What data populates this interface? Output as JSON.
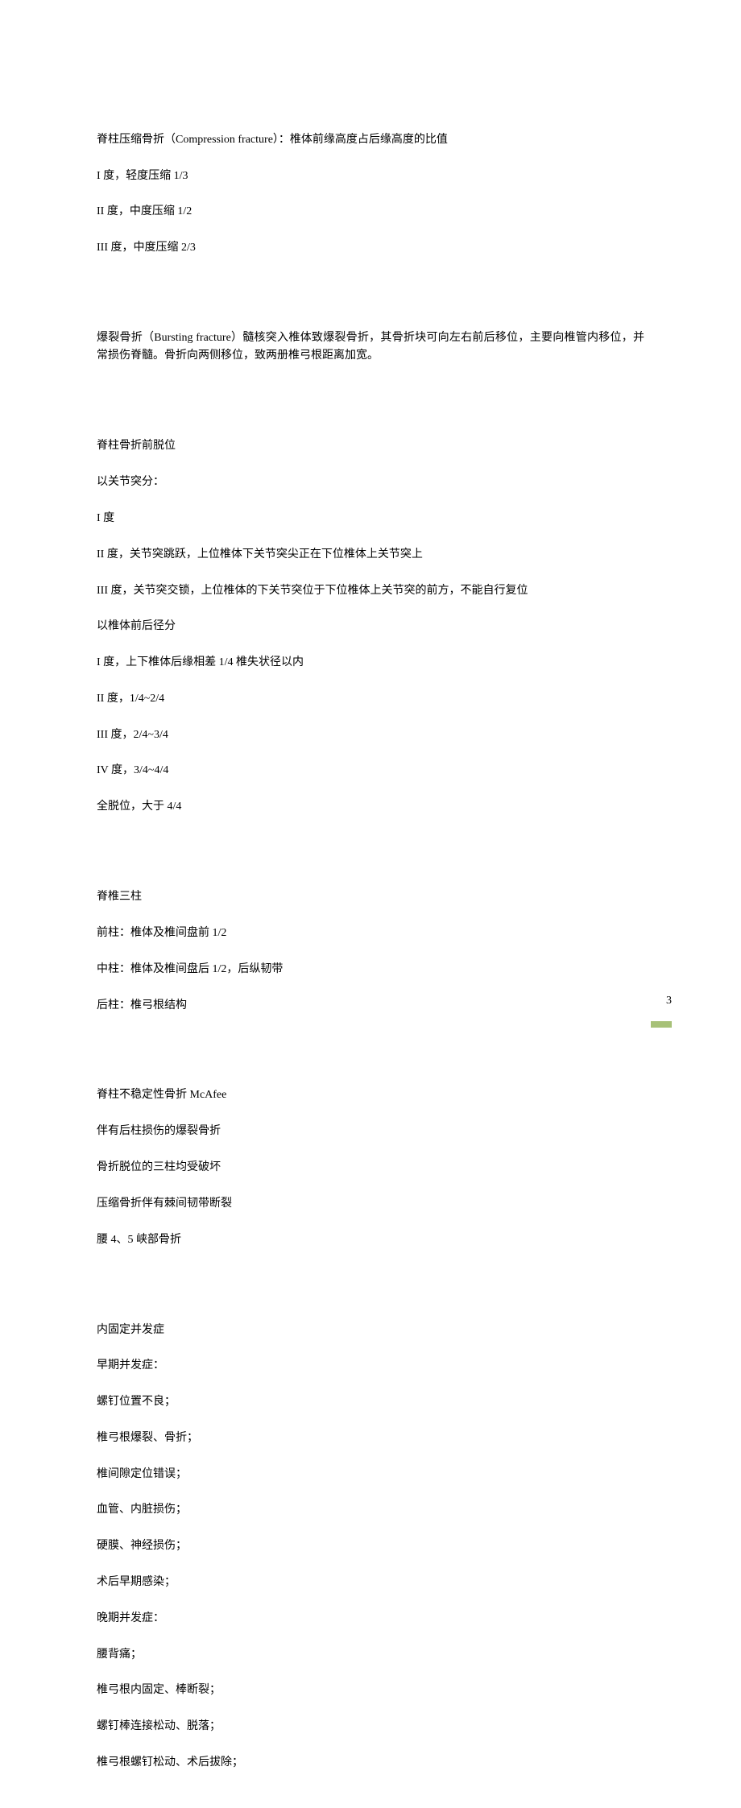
{
  "page_number": "3",
  "section1": {
    "line1": "脊柱压缩骨折（Compression fracture）：椎体前缘高度占后缘高度的比值",
    "line2": "I 度，轻度压缩 1/3",
    "line3": "II 度，中度压缩 1/2",
    "line4": "III 度，中度压缩 2/3"
  },
  "section2": {
    "line1": "爆裂骨折（Bursting fracture）髓核突入椎体致爆裂骨折，其骨折块可向左右前后移位，主要向椎管内移位，并常损伤脊髓。骨折向两侧移位，致两册椎弓根距离加宽。"
  },
  "section3": {
    "line1": "脊柱骨折前脱位",
    "line2": "以关节突分：",
    "line3": "I 度",
    "line4": "II 度，关节突跳跃，上位椎体下关节突尖正在下位椎体上关节突上",
    "line5": "III 度，关节突交锁，上位椎体的下关节突位于下位椎体上关节突的前方，不能自行复位",
    "line6": "以椎体前后径分",
    "line7": "I 度，上下椎体后缘相差 1/4 椎失状径以内",
    "line8": "II 度，1/4~2/4",
    "line9": "III 度，2/4~3/4",
    "line10": "IV 度，3/4~4/4",
    "line11": "全脱位，大于 4/4"
  },
  "section4": {
    "line1": "脊椎三柱",
    "line2": "前柱：椎体及椎间盘前 1/2",
    "line3": "中柱：椎体及椎间盘后 1/2，后纵韧带",
    "line4": "后柱：椎弓根结构"
  },
  "section5": {
    "line1": "脊柱不稳定性骨折 McAfee",
    "line2": "伴有后柱损伤的爆裂骨折",
    "line3": "骨折脱位的三柱均受破坏",
    "line4": "压缩骨折伴有棘间韧带断裂",
    "line5": "腰 4、5 峡部骨折"
  },
  "section6": {
    "line1": "内固定并发症",
    "line2": "早期并发症：",
    "line3": "螺钉位置不良；",
    "line4": "椎弓根爆裂、骨折；",
    "line5": "椎间隙定位错误；",
    "line6": "血管、内脏损伤；",
    "line7": "硬膜、神经损伤；",
    "line8": "术后早期感染；",
    "line9": "晚期并发症：",
    "line10": "腰背痛；",
    "line11": "椎弓根内固定、棒断裂；",
    "line12": "螺钉棒连接松动、脱落；",
    "line13": "椎弓根螺钉松动、术后拔除；"
  }
}
